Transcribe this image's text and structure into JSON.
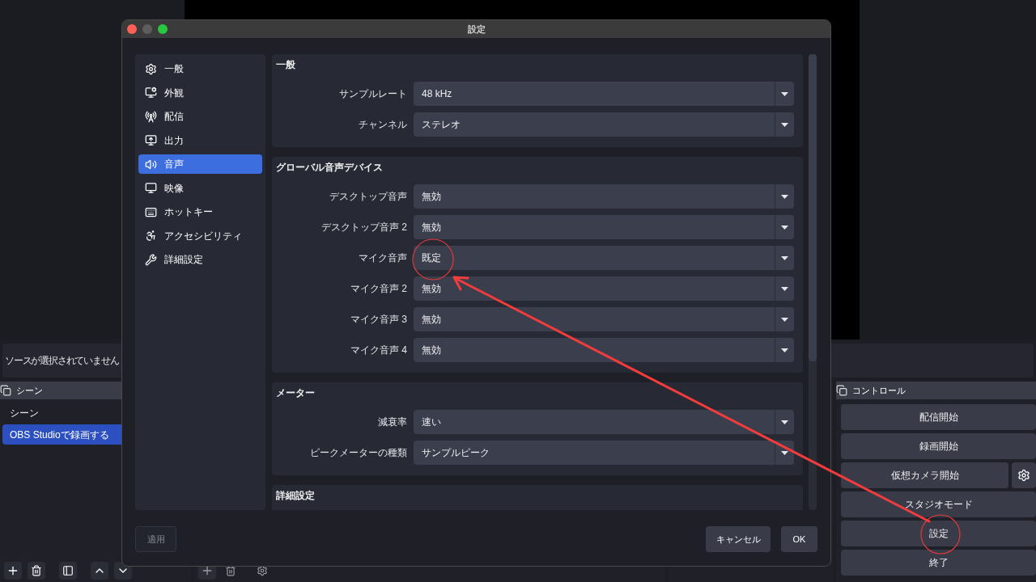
{
  "main": {
    "source_bar": {
      "text": "ソースが選択されていません"
    },
    "scenes_dock": {
      "title": "シーン",
      "items": [
        {
          "label": "シーン",
          "selected": false
        },
        {
          "label": "OBS Studioで録画する",
          "selected": true
        }
      ]
    },
    "controls_dock": {
      "title": "コントロール",
      "buttons": [
        {
          "label": "配信開始",
          "has_settings": false
        },
        {
          "label": "録画開始",
          "has_settings": false
        },
        {
          "label": "仮想カメラ開始",
          "has_settings": true
        },
        {
          "label": "スタジオモード",
          "has_settings": false
        },
        {
          "label": "設定",
          "has_settings": false
        },
        {
          "label": "終了",
          "has_settings": false
        }
      ]
    }
  },
  "dialog": {
    "title": "設定",
    "sidebar": [
      {
        "label": "一般",
        "selected": false
      },
      {
        "label": "外観",
        "selected": false
      },
      {
        "label": "配信",
        "selected": false
      },
      {
        "label": "出力",
        "selected": false
      },
      {
        "label": "音声",
        "selected": true
      },
      {
        "label": "映像",
        "selected": false
      },
      {
        "label": "ホットキー",
        "selected": false
      },
      {
        "label": "アクセシビリティ",
        "selected": false
      },
      {
        "label": "詳細設定",
        "selected": false
      }
    ],
    "groups": [
      {
        "title": "一般",
        "rows": [
          {
            "label": "サンプルレート",
            "value": "48 kHz"
          },
          {
            "label": "チャンネル",
            "value": "ステレオ"
          }
        ]
      },
      {
        "title": "グローバル音声デバイス",
        "rows": [
          {
            "label": "デスクトップ音声",
            "value": "無効"
          },
          {
            "label": "デスクトップ音声 2",
            "value": "無効"
          },
          {
            "label": "マイク音声",
            "value": "既定"
          },
          {
            "label": "マイク音声 2",
            "value": "無効"
          },
          {
            "label": "マイク音声 3",
            "value": "無効"
          },
          {
            "label": "マイク音声 4",
            "value": "無効"
          }
        ]
      },
      {
        "title": "メーター",
        "rows": [
          {
            "label": "減衰率",
            "value": "速い"
          },
          {
            "label": "ピークメーターの種類",
            "value": "サンプルピーク"
          }
        ]
      },
      {
        "title": "詳細設定"
      }
    ],
    "apply": {
      "label": "適用",
      "disabled": true
    },
    "cancel": {
      "label": "キャンセル"
    },
    "ok": {
      "label": "OK"
    }
  }
}
